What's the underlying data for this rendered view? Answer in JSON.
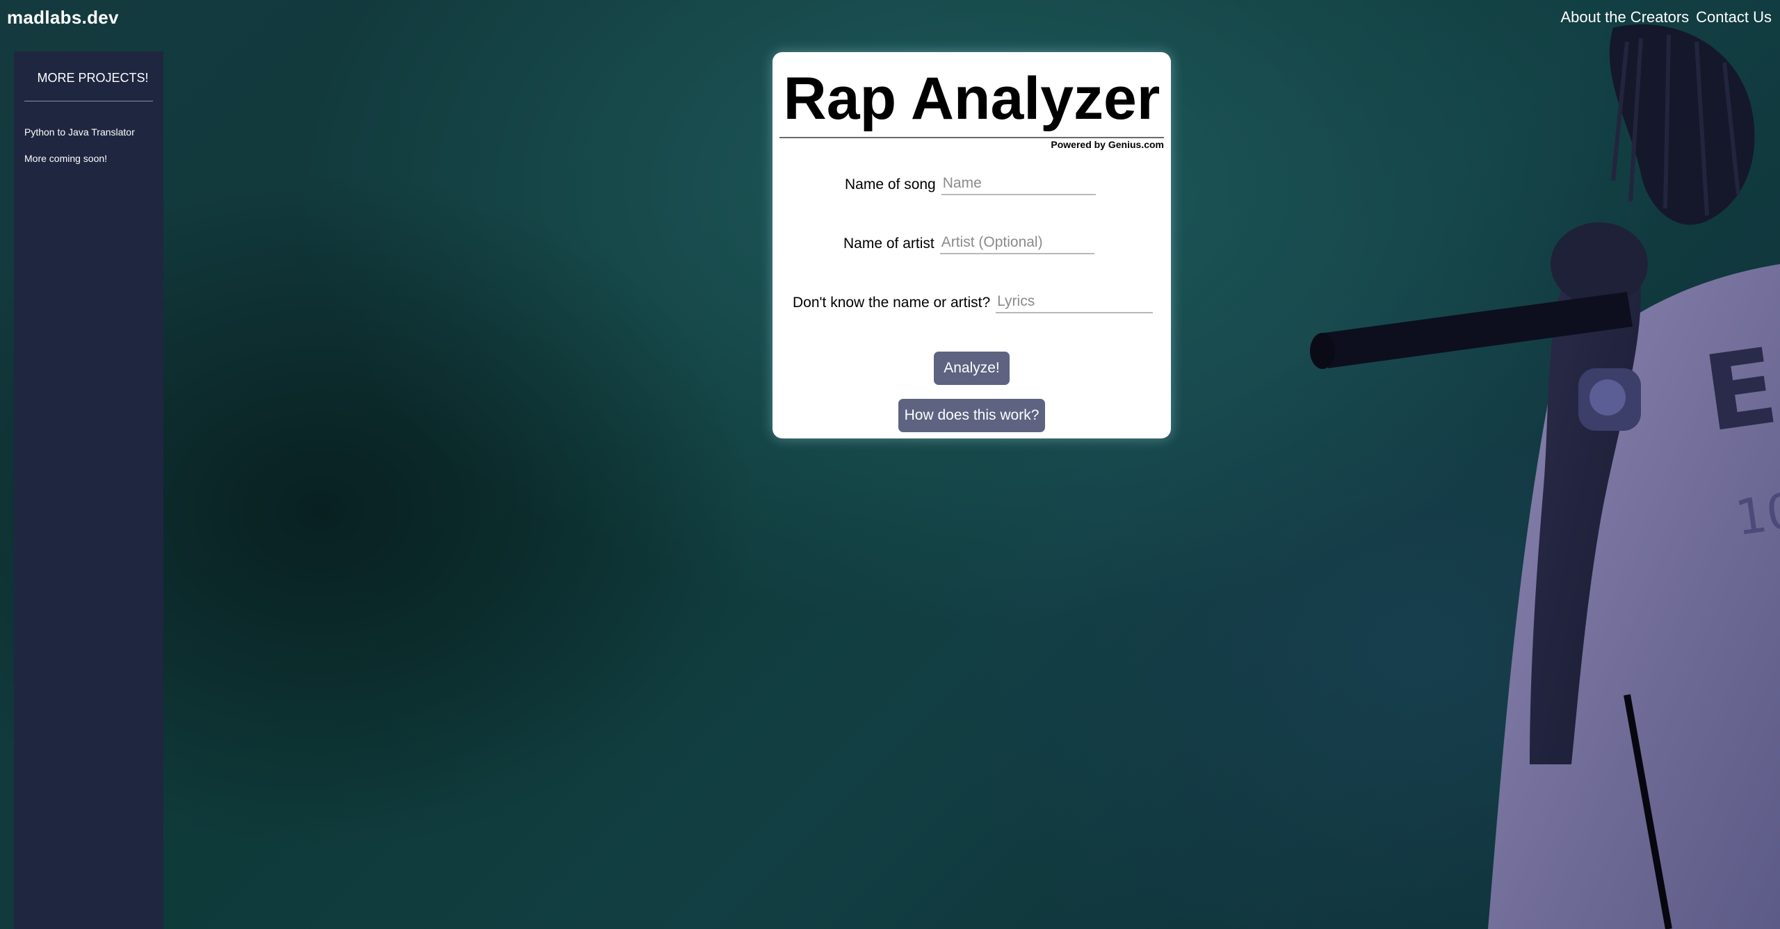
{
  "site": {
    "logo": "madlabs.dev"
  },
  "nav": {
    "items": [
      {
        "label": "About the Creators"
      },
      {
        "label": "Contact Us"
      }
    ]
  },
  "sidebar": {
    "title": "MORE PROJECTS!",
    "links": [
      {
        "label": "Python to Java Translator"
      },
      {
        "label": "More coming soon!"
      }
    ]
  },
  "card": {
    "title": "Rap Analyzer",
    "powered_by": "Powered by Genius.com",
    "fields": {
      "song": {
        "label": "Name of song",
        "placeholder": "Name",
        "value": ""
      },
      "artist": {
        "label": "Name of artist",
        "placeholder": "Artist (Optional)",
        "value": ""
      },
      "lyrics": {
        "label": "Don't know the name or artist?",
        "placeholder": "Lyrics",
        "value": ""
      }
    },
    "analyze_label": "Analyze!",
    "how_label": "How does this work?"
  },
  "theme": {
    "card_background": "#ffffff",
    "button_color": "#5d6380",
    "sidebar_color": "#1f2640",
    "background_teal": "#143a3f"
  }
}
